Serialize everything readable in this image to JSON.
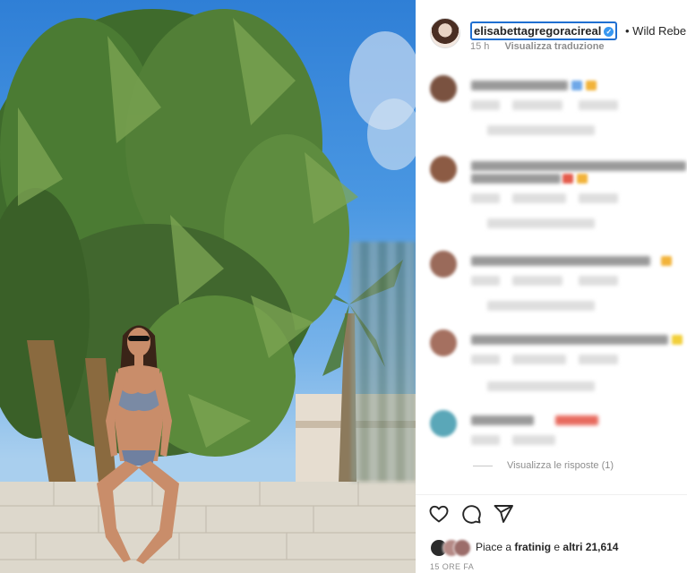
{
  "post": {
    "username": "elisabettagregoracireal",
    "caption": "Wild Rebel",
    "time_ago": "15 h",
    "translate_label": "Visualizza traduzione",
    "verified_glyph": "✓",
    "caption_emoji": "🤘"
  },
  "comments": {
    "view_replies_label": "Visualizza le risposte (1)"
  },
  "actions": {
    "like_icon": "heart-icon",
    "comment_icon": "comment-icon",
    "share_icon": "share-icon"
  },
  "likes": {
    "prefix": "Piace a",
    "user": "fratinig",
    "connector": "e",
    "others": "altri 21,614"
  },
  "timestamp": "15 ORE FA",
  "colors": {
    "focus_ring": "#1f6fd1",
    "verified": "#3897f0",
    "muted_text": "#8e8e8e"
  }
}
